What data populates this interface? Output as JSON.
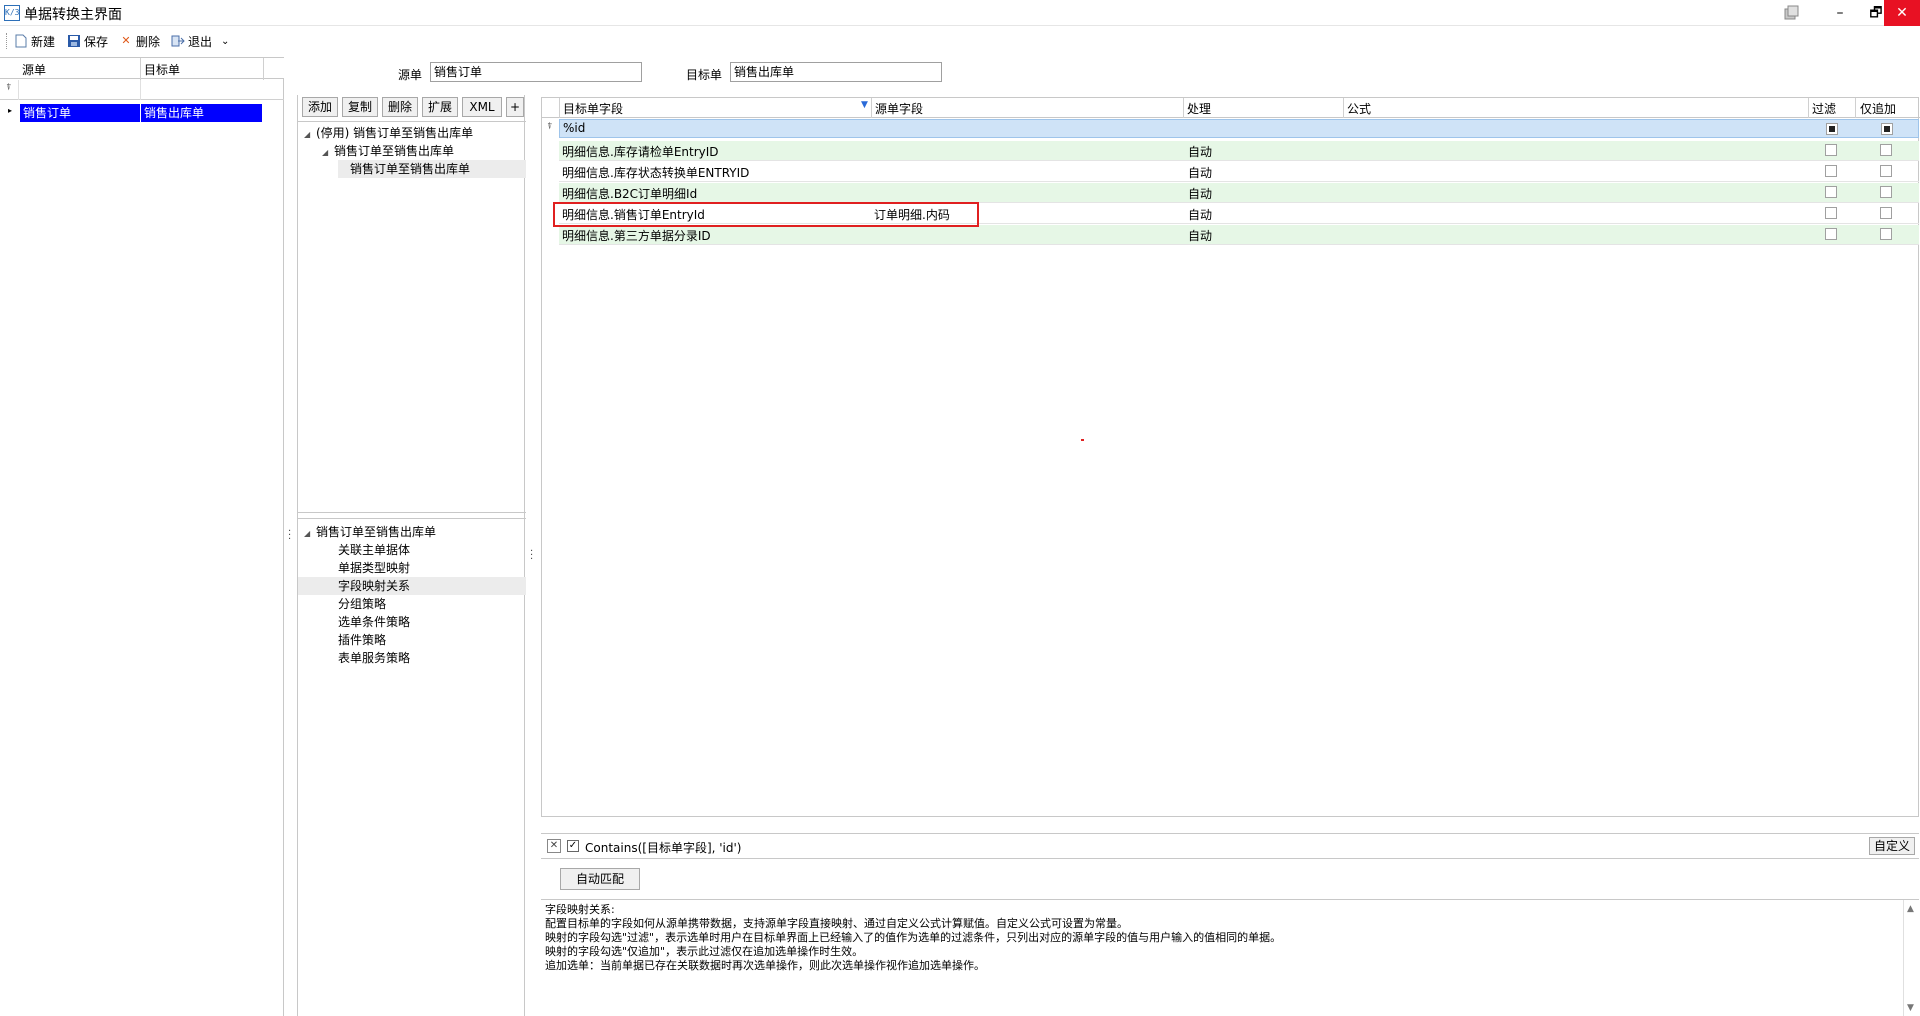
{
  "window": {
    "title": "单据转换主界面",
    "icon_text": "K/3",
    "min": "–",
    "max": "🗗",
    "close": "✕"
  },
  "toolbar": {
    "new_label": "新建",
    "save_label": "保存",
    "delete_label": "删除",
    "exit_label": "退出"
  },
  "left_grid": {
    "col_source": "源单",
    "col_target": "目标单",
    "filter_icon": "⍒",
    "rows": [
      {
        "source": "销售订单",
        "target": "销售出库单"
      }
    ]
  },
  "header_form": {
    "source_label": "源单",
    "source_value": "销售订单",
    "target_label": "目标单",
    "target_value": "销售出库单"
  },
  "mid_buttons": {
    "add": "添加",
    "copy": "复制",
    "delete": "删除",
    "extend": "扩展",
    "xml": "XML",
    "plus": "+"
  },
  "tree_top": [
    {
      "label": "(停用) 销售订单至销售出库单",
      "level": 0,
      "arrow": "◢"
    },
    {
      "label": "销售订单至销售出库单",
      "level": 1,
      "arrow": "◢"
    },
    {
      "label": "销售订单至销售出库单",
      "level": 2,
      "arrow": ""
    }
  ],
  "tree_bottom": {
    "root": "销售订单至销售出库单",
    "items": [
      "关联主单据体",
      "单据类型映射",
      "字段映射关系",
      "分组策略",
      "选单条件策略",
      "插件策略",
      "表单服务策略"
    ]
  },
  "right_grid": {
    "col_target_field": "目标单字段",
    "col_source_field": "源单字段",
    "col_process": "处理",
    "col_formula": "公式",
    "col_filter": "过滤",
    "col_append": "仅追加",
    "filter_value": "%id",
    "rows": [
      {
        "target": "明细信息.库存请检单EntryID",
        "source": "",
        "process": "自动",
        "formula": ""
      },
      {
        "target": "明细信息.库存状态转换单ENTRYID",
        "source": "",
        "process": "自动",
        "formula": ""
      },
      {
        "target": "明细信息.B2C订单明细Id",
        "source": "",
        "process": "自动",
        "formula": ""
      },
      {
        "target": "明细信息.销售订单EntryId",
        "source": "订单明细.内码",
        "process": "自动",
        "formula": ""
      },
      {
        "target": "明细信息.第三方单据分录ID",
        "source": "",
        "process": "自动",
        "formula": ""
      }
    ]
  },
  "filter_bar": {
    "expression": "Contains([目标单字段], 'id')",
    "custom_label": "自定义"
  },
  "auto_match_label": "自动匹配",
  "description": [
    "字段映射关系:",
    "配置目标单的字段如何从源单携带数据，支持源单字段直接映射、通过自定义公式计算赋值。自定义公式可设置为常量。",
    "映射的字段勾选\"过滤\"，表示选单时用户在目标单界面上已经输入了的值作为选单的过滤条件，只列出对应的源单字段的值与用户输入的值相同的单据。",
    "映射的字段勾选\"仅追加\"，表示此过滤仅在追加选单操作时生效。",
    "追加选单：当前单据已存在关联数据时再次选单操作，则此次选单操作视作追加选单操作。"
  ]
}
